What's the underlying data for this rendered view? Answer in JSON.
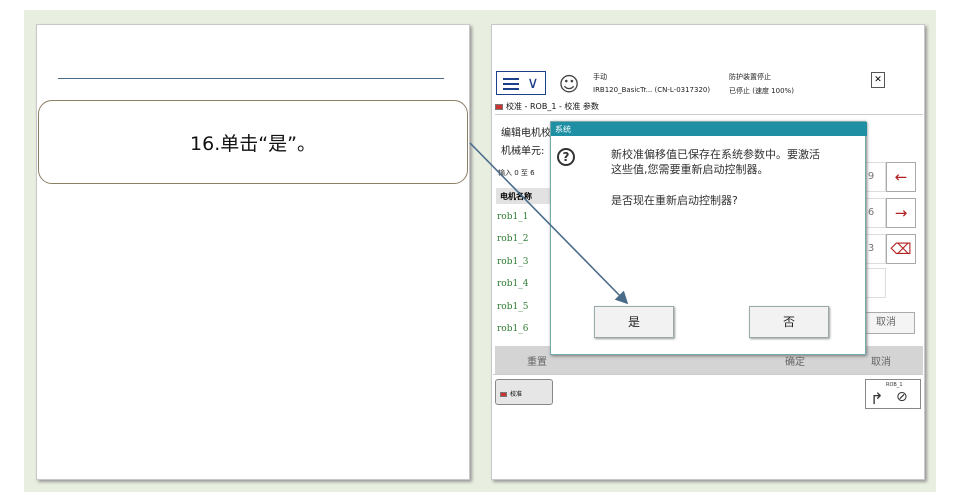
{
  "instruction": "16.单击“是”。",
  "flexpendant": {
    "mode": "手动",
    "controller": "IRB120_BasicTr... (CN-L-0317320)",
    "safety": "防护装置停止",
    "status": "已停止 (速度 100%)",
    "breadcrumb": "校准 - ROB_1 - 校准 参数",
    "text_line1": "编辑电机校",
    "text_line2": "机械单元:",
    "text_line3": "输入 0 至 6",
    "column_header": "电机名称",
    "motors": [
      "rob1_1",
      "rob1_2",
      "rob1_3",
      "rob1_4",
      "rob1_5",
      "rob1_6"
    ],
    "keypad": {
      "k9": "9",
      "k6": "6",
      "k3": "3",
      "back": "←",
      "forward": "→",
      "delete": "⌫"
    },
    "cancel": "取消",
    "bottom_reset": "重置",
    "bottom_ok": "确定",
    "bottom_cancel": "取消",
    "task_label": "校准",
    "jog_unit": "ROB_1",
    "menu_chevron": "∨",
    "user_icon": "user-icon",
    "hdr_icon": "close-icon"
  },
  "dialog": {
    "title": "系统",
    "message_line1": "新校准偏移值已保存在系统参数中。要激活",
    "message_line2": "这些值,您需要重新启动控制器。",
    "question": "是否现在重新启动控制器?",
    "yes": "是",
    "no": "否",
    "icon": "?"
  },
  "colors": {
    "background": "#e9efe0",
    "dialog_title": "#1f8fa3",
    "motor_text": "#2e7d32",
    "arrow": "#4a6b8a",
    "key_accent": "#b42020"
  }
}
